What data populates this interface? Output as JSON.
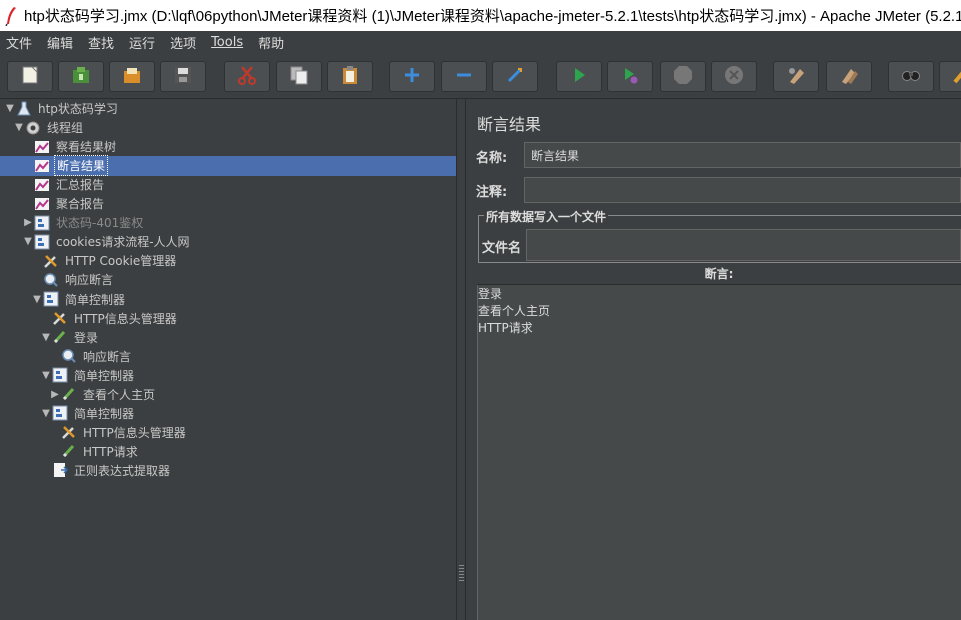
{
  "window": {
    "title": "htp状态码学习.jmx (D:\\lqf\\06python\\JMeter课程资料 (1)\\JMeter课程资料\\apache-jmeter-5.2.1\\tests\\htp状态码学习.jmx) - Apache JMeter (5.2.1)"
  },
  "menu": [
    "文件",
    "编辑",
    "查找",
    "运行",
    "选项",
    "Tools",
    "帮助"
  ],
  "toolbar": {
    "buttons": [
      "new-icon",
      "templates-icon",
      "open-icon",
      "save-icon",
      "cut-icon",
      "copy-icon",
      "paste-icon",
      "expand-icon",
      "collapse-icon",
      "toggle-icon",
      "start-icon",
      "start-no-pauses-icon",
      "stop-icon",
      "shutdown-icon",
      "clear-icon",
      "clear-all-icon",
      "search-icon",
      "reset-search-icon"
    ]
  },
  "tree": [
    {
      "label": "htp状态码学习",
      "icon": "testplan-icon",
      "toggle": "▼",
      "level": 0
    },
    {
      "label": "线程组",
      "icon": "threadgroup-icon",
      "toggle": "▼",
      "level": 1
    },
    {
      "label": "察看结果树",
      "icon": "listener-icon",
      "toggle": "",
      "level": 2
    },
    {
      "label": "断言结果",
      "icon": "listener-icon",
      "toggle": "",
      "level": 2,
      "selected": true
    },
    {
      "label": "汇总报告",
      "icon": "listener-icon",
      "toggle": "",
      "level": 2
    },
    {
      "label": "聚合报告",
      "icon": "listener-icon",
      "toggle": "",
      "level": 2
    },
    {
      "label": "状态码-401鉴权",
      "icon": "controller-icon",
      "toggle": "▶",
      "level": 2,
      "disabled": true
    },
    {
      "label": "cookies请求流程-人人网",
      "icon": "controller-icon",
      "toggle": "▼",
      "level": 2
    },
    {
      "label": "HTTP Cookie管理器",
      "icon": "config-icon",
      "toggle": "",
      "level": 3
    },
    {
      "label": "响应断言",
      "icon": "assertion-icon",
      "toggle": "",
      "level": 3
    },
    {
      "label": "简单控制器",
      "icon": "controller-icon",
      "toggle": "▼",
      "level": 3
    },
    {
      "label": "HTTP信息头管理器",
      "icon": "config-icon",
      "toggle": "",
      "level": 4
    },
    {
      "label": "登录",
      "icon": "sampler-icon",
      "toggle": "▼",
      "level": 4
    },
    {
      "label": "响应断言",
      "icon": "assertion-icon",
      "toggle": "",
      "level": 5
    },
    {
      "label": "简单控制器",
      "icon": "controller-icon",
      "toggle": "▼",
      "level": 4
    },
    {
      "label": "查看个人主页",
      "icon": "sampler-icon",
      "toggle": "▶",
      "level": 5
    },
    {
      "label": "简单控制器",
      "icon": "controller-icon",
      "toggle": "▼",
      "level": 4
    },
    {
      "label": "HTTP信息头管理器",
      "icon": "config-icon",
      "toggle": "",
      "level": 5
    },
    {
      "label": "HTTP请求",
      "icon": "sampler-icon",
      "toggle": "",
      "level": 5
    },
    {
      "label": "正则表达式提取器",
      "icon": "extractor-icon",
      "toggle": "",
      "level": 4
    }
  ],
  "panel": {
    "title": "断言结果",
    "name_label": "名称:",
    "name_value": "断言结果",
    "comment_label": "注释:",
    "comment_value": "",
    "file_group_label": "所有数据写入一个文件",
    "filename_label": "文件名",
    "filename_value": "",
    "assertions_header": "断言:",
    "assertion_lines": [
      "登录",
      "查看个人主页",
      "HTTP请求"
    ]
  }
}
